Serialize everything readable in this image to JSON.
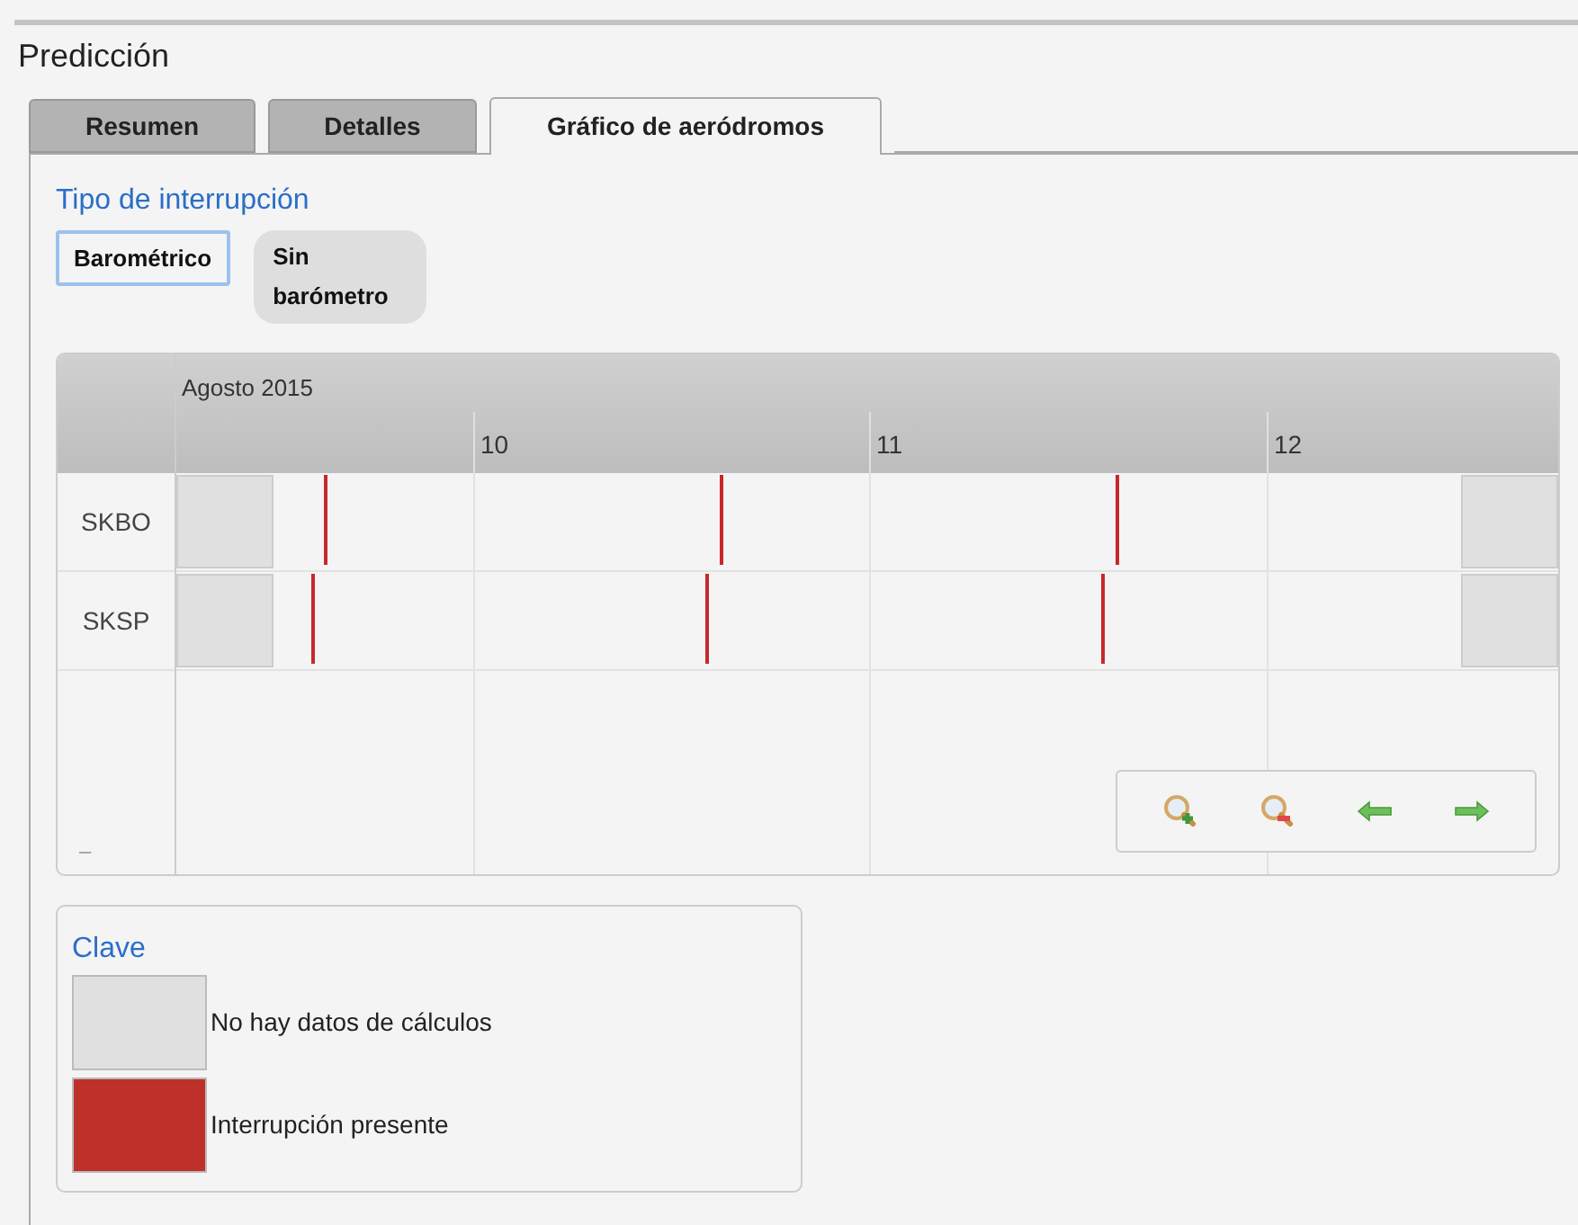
{
  "title": "Predicción",
  "tabs": [
    {
      "label": "Resumen",
      "selected": false
    },
    {
      "label": "Detalles",
      "selected": false
    },
    {
      "label": "Gráfico de aeródromos",
      "selected": true
    }
  ],
  "interruption_type": {
    "heading": "Tipo de interrupción",
    "options": [
      {
        "label": "Barométrico",
        "selected": true
      },
      {
        "label": "Sin barómetro",
        "selected": false
      }
    ]
  },
  "timeline": {
    "month": "Agosto 2015",
    "days": [
      "10",
      "11",
      "12"
    ],
    "rows": [
      {
        "name": "SKBO",
        "no_data_start": true,
        "no_data_end": true,
        "interruptions": true
      },
      {
        "name": "SKSP",
        "no_data_start": true,
        "no_data_end": true,
        "interruptions": true
      }
    ],
    "footer_mark": "–"
  },
  "legend": {
    "title": "Clave",
    "items": [
      {
        "label": "No hay datos de cálculos",
        "color": "#e0e0e0"
      },
      {
        "label": "Interrupción presente",
        "color": "#c0302b"
      }
    ]
  }
}
